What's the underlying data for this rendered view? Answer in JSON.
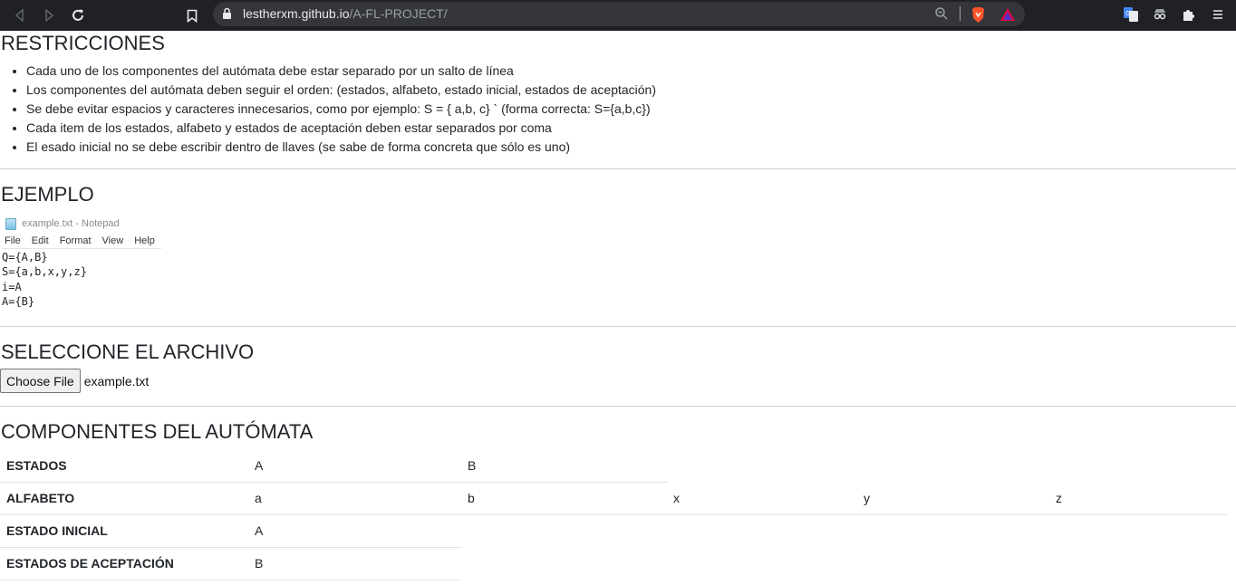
{
  "browser": {
    "url_host": "lestherxm.github.io",
    "url_path": "/A-FL-PROJECT/"
  },
  "restricciones": {
    "title": "RESTRICCIONES",
    "items": [
      "Cada uno de los componentes del autómata debe estar separado por un salto de línea",
      "Los componentes del autómata deben seguir el orden: (estados, alfabeto, estado inicial, estados de aceptación)",
      "Se debe evitar espacios y caracteres innecesarios, como por ejemplo: S = { a,b, c} ` (forma correcta: S={a,b,c})",
      "Cada item de los estados, alfabeto y estados de aceptación deben estar separados por coma",
      "El esado inicial no se debe escribir dentro de llaves (se sabe de forma concreta que sólo es uno)"
    ]
  },
  "ejemplo": {
    "title": "EJEMPLO",
    "notepad": {
      "window_title": "example.txt - Notepad",
      "menu": [
        "File",
        "Edit",
        "Format",
        "View",
        "Help"
      ],
      "lines": [
        "Q={A,B}",
        "S={a,b,x,y,z}",
        "i=A",
        "A={B}"
      ]
    }
  },
  "archivo": {
    "title": "SELECCIONE EL ARCHIVO",
    "button_label": "Choose File",
    "file_name": "example.txt"
  },
  "componentes": {
    "title": "COMPONENTES DEL AUTÓMATA",
    "rows": [
      {
        "label": "ESTADOS",
        "values": [
          "A",
          "B"
        ]
      },
      {
        "label": "ALFABETO",
        "values": [
          "a",
          "b",
          "x",
          "y",
          "z"
        ]
      },
      {
        "label": "ESTADO INICIAL",
        "values": [
          "A"
        ]
      },
      {
        "label": "ESTADOS DE ACEPTACIÓN",
        "values": [
          "B"
        ]
      }
    ]
  }
}
